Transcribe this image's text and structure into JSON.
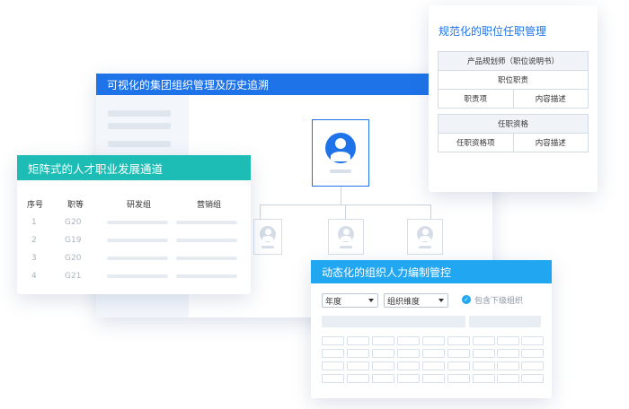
{
  "org_chart": {
    "title": "可视化的集团组织管理及历史追溯"
  },
  "matrix": {
    "title": "矩阵式的人才职业发展通道",
    "headers": [
      "序号",
      "职等",
      "研发组",
      "营销组"
    ],
    "rows": [
      {
        "seq": "1",
        "grade": "G20"
      },
      {
        "seq": "2",
        "grade": "G19"
      },
      {
        "seq": "3",
        "grade": "G20"
      },
      {
        "seq": "4",
        "grade": "G21"
      }
    ]
  },
  "position": {
    "title": "规范化的职位任职管理",
    "table1": {
      "header": "产品规划师（职位说明书）",
      "subheader": "职位职责",
      "col1": "职责项",
      "col2": "内容描述"
    },
    "table2": {
      "header": "任职资格",
      "col1": "任职资格项",
      "col2": "内容描述"
    }
  },
  "staffing": {
    "title": "动态化的组织人力编制管控",
    "select_year": "年度",
    "select_dimension": "组织维度",
    "checkbox_label": "包含下级组织",
    "checkbox_checked": true
  },
  "colors": {
    "org_header": "#1e73e8",
    "matrix_header": "#1dbdb5",
    "staff_header": "#21a7f1",
    "accent": "#1e73e8"
  },
  "icons": [
    "user-avatar-icon",
    "checkmark-icon",
    "chevron-down-icon"
  ]
}
